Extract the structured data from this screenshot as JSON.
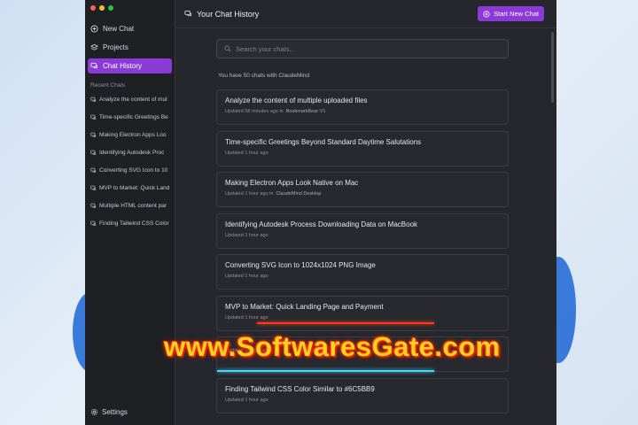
{
  "sidebar": {
    "nav": [
      {
        "label": "New Chat",
        "icon": "plus-circle-icon"
      },
      {
        "label": "Projects",
        "icon": "layers-icon"
      },
      {
        "label": "Chat History",
        "icon": "chat-bubbles-icon",
        "active": true
      }
    ],
    "recent_label": "Recent Chats",
    "recent": [
      "Analyze the content of mul",
      "Time-specific Greetings Be",
      "Making Electron Apps Loo",
      "Identifying Autodesk Proc",
      "Converting SVG Icon to 10",
      "MVP to Market: Quick Land",
      "Multiple HTML content par",
      "Finding Tailwind CSS Color"
    ],
    "settings_label": "Settings"
  },
  "header": {
    "title": "Your Chat History",
    "new_chat_button": "Start New Chat"
  },
  "search": {
    "placeholder": "Search your chats..."
  },
  "summary": "You have 50 chats with ClaudeMind",
  "chats": [
    {
      "title": "Analyze the content of multiple uploaded files",
      "updated": "Updated 58 minutes ago in",
      "project": "BookmarkBear V1"
    },
    {
      "title": "Time-specific Greetings Beyond Standard Daytime Salutations",
      "updated": "Updated 1 hour ago",
      "project": ""
    },
    {
      "title": "Making Electron Apps Look Native on Mac",
      "updated": "Updated 1 hour ago in",
      "project": "ClaudeMind Desktop"
    },
    {
      "title": "Identifying Autodesk Process Downloading Data on MacBook",
      "updated": "Updated 1 hour ago",
      "project": ""
    },
    {
      "title": "Converting SVG Icon to 1024x1024 PNG Image",
      "updated": "Updated 1 hour ago",
      "project": ""
    },
    {
      "title": "MVP to Market: Quick Landing Page and Payment",
      "updated": "Updated 1 hour ago",
      "project": ""
    },
    {
      "title": "",
      "updated": "Updated 1 hour ago",
      "project": ""
    },
    {
      "title": "Finding Tailwind CSS Color Similar to #6C5BB9",
      "updated": "Updated 1 hour ago",
      "project": ""
    }
  ],
  "watermark": "www.SoftwaresGate.com",
  "colors": {
    "accent": "#8b3ad8",
    "sidebar_bg": "#1f2024",
    "main_bg": "#25272c",
    "watermark": "#ffd21f"
  }
}
